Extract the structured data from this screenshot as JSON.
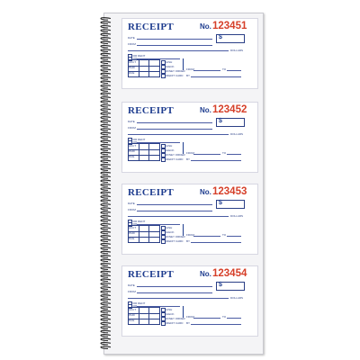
{
  "receipts": [
    {
      "title": "RECEIPT",
      "no_label": "No.",
      "number": "123451"
    },
    {
      "title": "RECEIPT",
      "no_label": "No.",
      "number": "123452"
    },
    {
      "title": "RECEIPT",
      "no_label": "No.",
      "number": "123453"
    },
    {
      "title": "RECEIPT",
      "no_label": "No.",
      "number": "123454"
    }
  ],
  "labels": {
    "date": "DATE",
    "from": "FROM",
    "dollars": "DOLLARS",
    "dollar_sign": "$",
    "for_rent": "FOR RENT",
    "for": "FOR",
    "acct": "ACCT",
    "paid": "PAID",
    "due": "DUE",
    "cash": "CASH",
    "check": "CHECK",
    "money_order": "MONEY ORDER",
    "credit_card": "CREDIT CARD",
    "from2": "FROM",
    "to": "TO",
    "by": "BY"
  },
  "colors": {
    "title_blue": "#1f3d8f",
    "number_red": "#d6402a",
    "line_blue": "#4a5ba3"
  }
}
